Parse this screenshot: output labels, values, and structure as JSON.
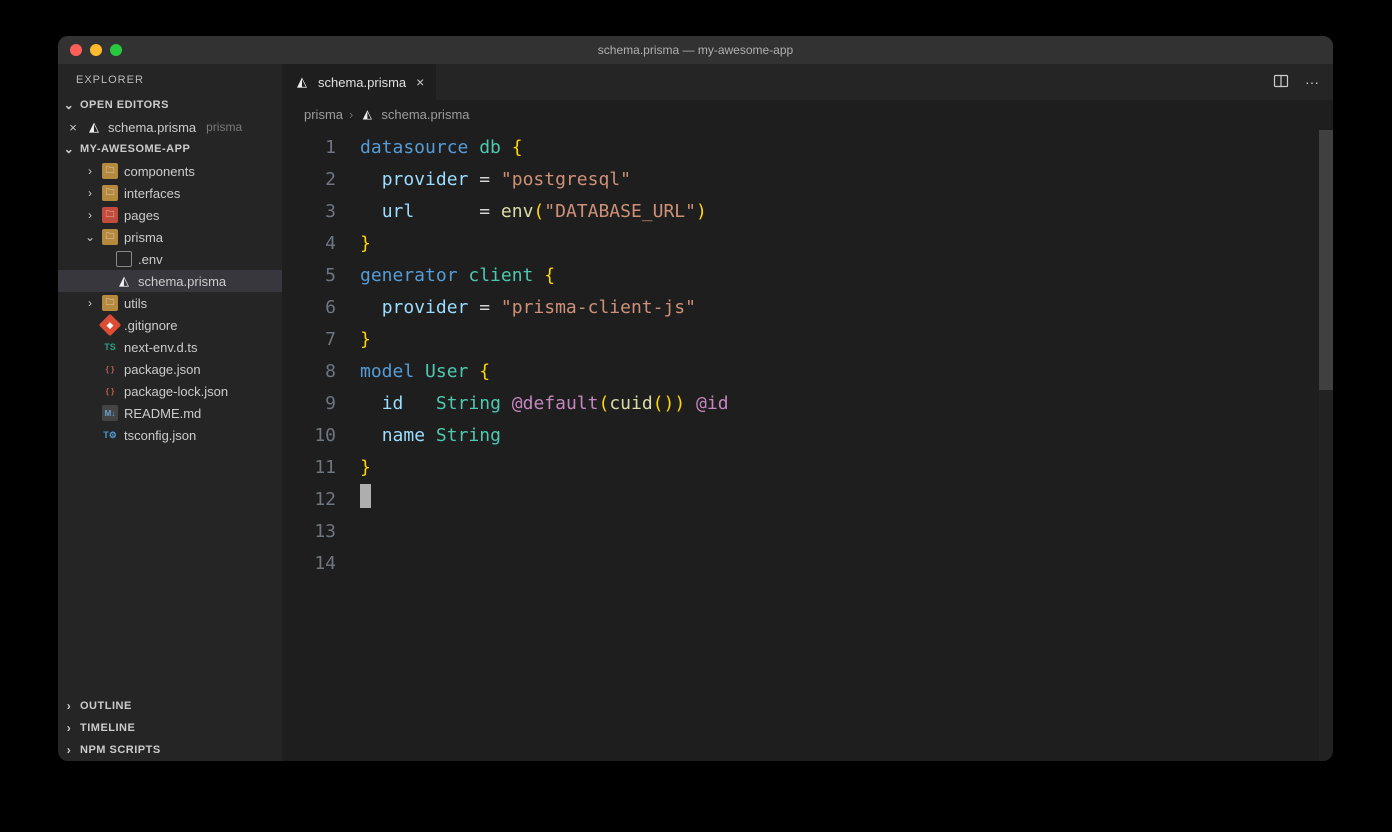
{
  "window": {
    "title": "schema.prisma — my-awesome-app"
  },
  "sidebar": {
    "title": "EXPLORER",
    "sections": {
      "openEditors": {
        "label": "OPEN EDITORS",
        "items": [
          {
            "name": "schema.prisma",
            "folder": "prisma"
          }
        ]
      },
      "project": {
        "label": "MY-AWESOME-APP",
        "tree": [
          {
            "label": "components",
            "type": "folder",
            "indent": 1,
            "expanded": false,
            "iconClass": "icon-folder"
          },
          {
            "label": "interfaces",
            "type": "folder",
            "indent": 1,
            "expanded": false,
            "iconClass": "icon-folder"
          },
          {
            "label": "pages",
            "type": "folder",
            "indent": 1,
            "expanded": false,
            "iconClass": "icon-folder-red"
          },
          {
            "label": "prisma",
            "type": "folder",
            "indent": 1,
            "expanded": true,
            "iconClass": "icon-folder"
          },
          {
            "label": ".env",
            "type": "file",
            "indent": 2,
            "iconClass": "icon-file"
          },
          {
            "label": "schema.prisma",
            "type": "file",
            "indent": 2,
            "iconClass": "icon-prisma",
            "selected": true
          },
          {
            "label": "utils",
            "type": "folder",
            "indent": 1,
            "expanded": false,
            "iconClass": "icon-folder"
          },
          {
            "label": ".gitignore",
            "type": "file",
            "indent": 1,
            "iconClass": "icon-git"
          },
          {
            "label": "next-env.d.ts",
            "type": "file",
            "indent": 1,
            "iconClass": "icon-ts"
          },
          {
            "label": "package.json",
            "type": "file",
            "indent": 1,
            "iconClass": "icon-json"
          },
          {
            "label": "package-lock.json",
            "type": "file",
            "indent": 1,
            "iconClass": "icon-json"
          },
          {
            "label": "README.md",
            "type": "file",
            "indent": 1,
            "iconClass": "icon-md"
          },
          {
            "label": "tsconfig.json",
            "type": "file",
            "indent": 1,
            "iconClass": "icon-tsconfig"
          }
        ]
      },
      "outline": {
        "label": "OUTLINE"
      },
      "timeline": {
        "label": "TIMELINE"
      },
      "npm": {
        "label": "NPM SCRIPTS"
      }
    }
  },
  "tabs": {
    "active": {
      "label": "schema.prisma"
    }
  },
  "breadcrumbs": {
    "parts": [
      "prisma",
      "schema.prisma"
    ]
  },
  "editor": {
    "lineCount": 14,
    "lines": [
      [
        {
          "t": "datasource ",
          "c": "tok-kw"
        },
        {
          "t": "db ",
          "c": "tok-id"
        },
        {
          "t": "{",
          "c": "tok-br"
        }
      ],
      [
        {
          "t": "  ",
          "c": ""
        },
        {
          "t": "provider",
          "c": "tok-prop"
        },
        {
          "t": " = ",
          "c": "tok-punct"
        },
        {
          "t": "\"postgresql\"",
          "c": "tok-str"
        }
      ],
      [
        {
          "t": "  ",
          "c": ""
        },
        {
          "t": "url",
          "c": "tok-prop"
        },
        {
          "t": "      = ",
          "c": "tok-punct"
        },
        {
          "t": "env",
          "c": "tok-fn"
        },
        {
          "t": "(",
          "c": "tok-br"
        },
        {
          "t": "\"DATABASE_URL\"",
          "c": "tok-str"
        },
        {
          "t": ")",
          "c": "tok-br"
        }
      ],
      [
        {
          "t": "}",
          "c": "tok-br"
        }
      ],
      [
        {
          "t": "",
          "c": ""
        }
      ],
      [
        {
          "t": "generator ",
          "c": "tok-kw"
        },
        {
          "t": "client ",
          "c": "tok-id"
        },
        {
          "t": "{",
          "c": "tok-br"
        }
      ],
      [
        {
          "t": "  ",
          "c": ""
        },
        {
          "t": "provider",
          "c": "tok-prop"
        },
        {
          "t": " = ",
          "c": "tok-punct"
        },
        {
          "t": "\"prisma-client-js\"",
          "c": "tok-str"
        }
      ],
      [
        {
          "t": "}",
          "c": "tok-br"
        }
      ],
      [
        {
          "t": "",
          "c": ""
        }
      ],
      [
        {
          "t": "model ",
          "c": "tok-kw"
        },
        {
          "t": "User ",
          "c": "tok-id"
        },
        {
          "t": "{",
          "c": "tok-br"
        }
      ],
      [
        {
          "t": "  ",
          "c": ""
        },
        {
          "t": "id",
          "c": "tok-prop"
        },
        {
          "t": "   ",
          "c": ""
        },
        {
          "t": "String",
          "c": "tok-id"
        },
        {
          "t": " ",
          "c": ""
        },
        {
          "t": "@default",
          "c": "tok-attr"
        },
        {
          "t": "(",
          "c": "tok-br"
        },
        {
          "t": "cuid",
          "c": "tok-fn"
        },
        {
          "t": "()",
          "c": "tok-br"
        },
        {
          "t": ")",
          "c": "tok-br"
        },
        {
          "t": " ",
          "c": ""
        },
        {
          "t": "@id",
          "c": "tok-attr"
        }
      ],
      [
        {
          "t": "  ",
          "c": ""
        },
        {
          "t": "name",
          "c": "tok-prop"
        },
        {
          "t": " ",
          "c": ""
        },
        {
          "t": "String",
          "c": "tok-id"
        }
      ],
      [
        {
          "t": "}",
          "c": "tok-br"
        }
      ],
      [
        {
          "t": "",
          "c": "",
          "cursor": true
        }
      ]
    ]
  }
}
